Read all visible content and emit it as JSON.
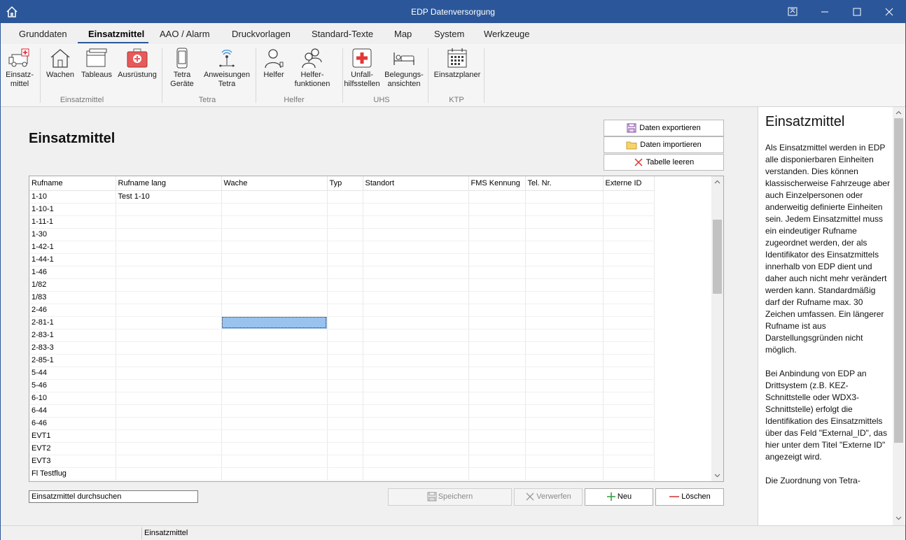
{
  "window": {
    "title": "EDP Datenversorgung"
  },
  "tabs": [
    "Grunddaten",
    "Einsatzmittel",
    "AAO / Alarm",
    "Druckvorlagen",
    "Standard-Texte",
    "Map",
    "System",
    "Werkzeuge"
  ],
  "ribbon": {
    "buttons": [
      "Einsatz-",
      "mittel",
      "Wachen",
      "Tableaus",
      "Ausrüstung",
      "Tetra",
      "Geräte",
      "Anweisungen",
      "Tetra",
      "Helfer",
      "Helfer-",
      "funktionen",
      "Unfall-",
      "hilfsstellen",
      "Belegungs-",
      "ansichten",
      "Einsatzplaner"
    ],
    "groups": [
      "Einsatzmittel",
      "Tetra",
      "Helfer",
      "UHS",
      "KTP"
    ]
  },
  "main": {
    "title": "Einsatzmittel",
    "export_label": "Daten exportieren",
    "import_label": "Daten importieren",
    "clear_label": "Tabelle leeren",
    "search_value": "Einsatzmittel durchsuchen",
    "save_label": "Speichern",
    "discard_label": "Verwerfen",
    "new_label": "Neu",
    "delete_label": "Löschen"
  },
  "table": {
    "columns": [
      "Rufname",
      "Rufname lang",
      "Wache",
      "Typ",
      "Standort",
      "FMS Kennung",
      "Tel. Nr.",
      "Externe ID"
    ],
    "rows": [
      [
        "1-10",
        "Test 1-10"
      ],
      [
        "1-10-1",
        ""
      ],
      [
        "1-11-1",
        ""
      ],
      [
        "1-30",
        ""
      ],
      [
        "1-42-1",
        ""
      ],
      [
        "1-44-1",
        ""
      ],
      [
        "1-46",
        ""
      ],
      [
        "1/82",
        ""
      ],
      [
        "1/83",
        ""
      ],
      [
        "2-46",
        ""
      ],
      [
        "2-81-1",
        ""
      ],
      [
        "2-83-1",
        ""
      ],
      [
        "2-83-3",
        ""
      ],
      [
        "2-85-1",
        ""
      ],
      [
        "5-44",
        ""
      ],
      [
        "5-46",
        ""
      ],
      [
        "6-10",
        ""
      ],
      [
        "6-44",
        ""
      ],
      [
        "6-46",
        ""
      ],
      [
        "EVT1",
        ""
      ],
      [
        "EVT2",
        ""
      ],
      [
        "EVT3",
        ""
      ],
      [
        "Fl Testflug",
        ""
      ]
    ]
  },
  "help": {
    "title": "Einsatzmittel",
    "p1": "Als Einsatzmittel werden in EDP alle disponierbaren Einheiten verstanden. Dies können klassischerweise Fahrzeuge aber auch Einzelpersonen oder anderweitig definierte Einheiten sein. Jedem Einsatzmittel muss ein eindeutiger Rufname zugeordnet werden, der als Identifikator des Einsatzmittels innerhalb von EDP dient und daher auch nicht mehr verändert werden kann. Standardmäßig darf der Rufname max. 30 Zeichen umfassen. Ein längerer Rufname ist aus Darstellungsgründen nicht möglich.",
    "p2": "Bei Anbindung von EDP an Drittsystem (z.B. KEZ-Schnittstelle oder WDX3-Schnittstelle) erfolgt die Identifikation des Einsatzmittels über das Feld \"External_ID\", das hier unter dem Titel \"Externe ID\" angezeigt wird.",
    "p3": "Die Zuordnung von Tetra-"
  },
  "status": {
    "text": "Einsatzmittel"
  }
}
